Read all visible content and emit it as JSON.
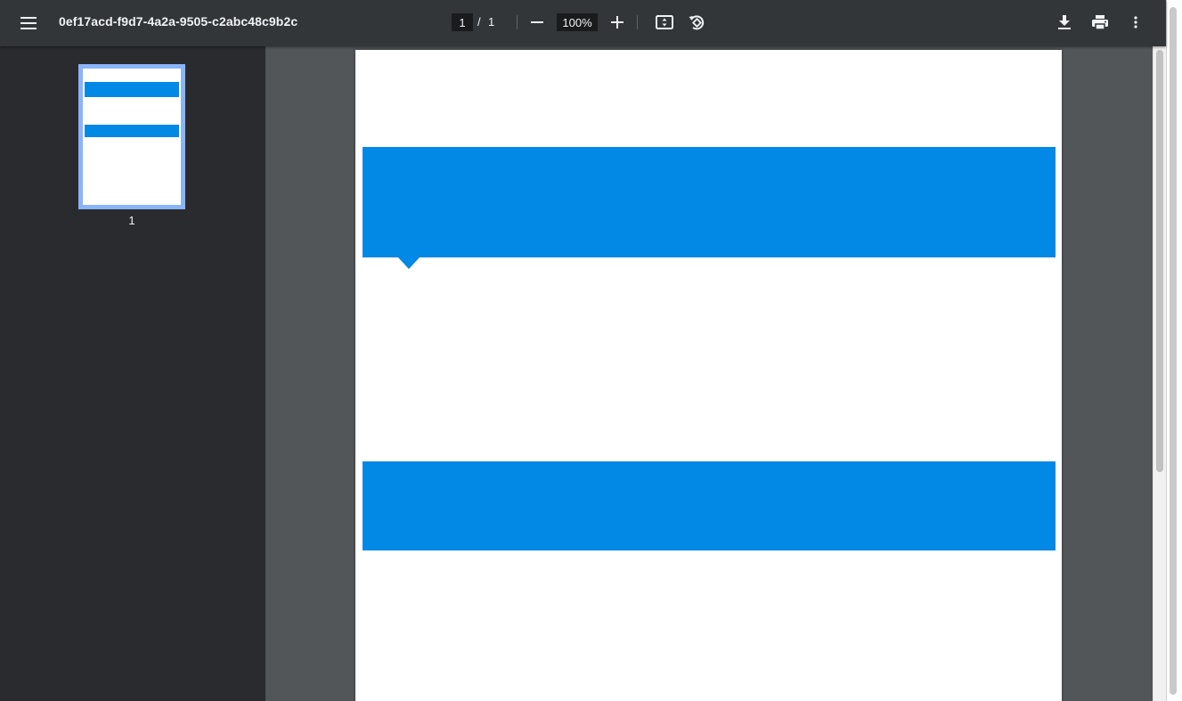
{
  "toolbar": {
    "title": "0ef17acd-f9d7-4a2a-9505-c2abc48c9b2c",
    "current_page": "1",
    "page_separator": "/",
    "total_pages": "1",
    "zoom_level": "100%",
    "icons": {
      "menu": "menu-icon",
      "zoom_out": "minus-icon",
      "zoom_in": "plus-icon",
      "fit": "fit-to-page-icon",
      "rotate": "rotate-counterclockwise-icon",
      "download": "download-icon",
      "print": "print-icon",
      "more": "more-vertical-icon"
    }
  },
  "sidebar": {
    "thumbnails": [
      {
        "label": "1",
        "selected": true
      }
    ]
  },
  "document": {
    "banner_color": "#0288e5",
    "page_color": "#ffffff"
  },
  "colors": {
    "toolbar_bg": "#323639",
    "sidebar_bg": "#292b2e",
    "viewer_bg": "#525659",
    "thumb_selected": "#8ab4f8",
    "text": "#f1f3f4"
  }
}
